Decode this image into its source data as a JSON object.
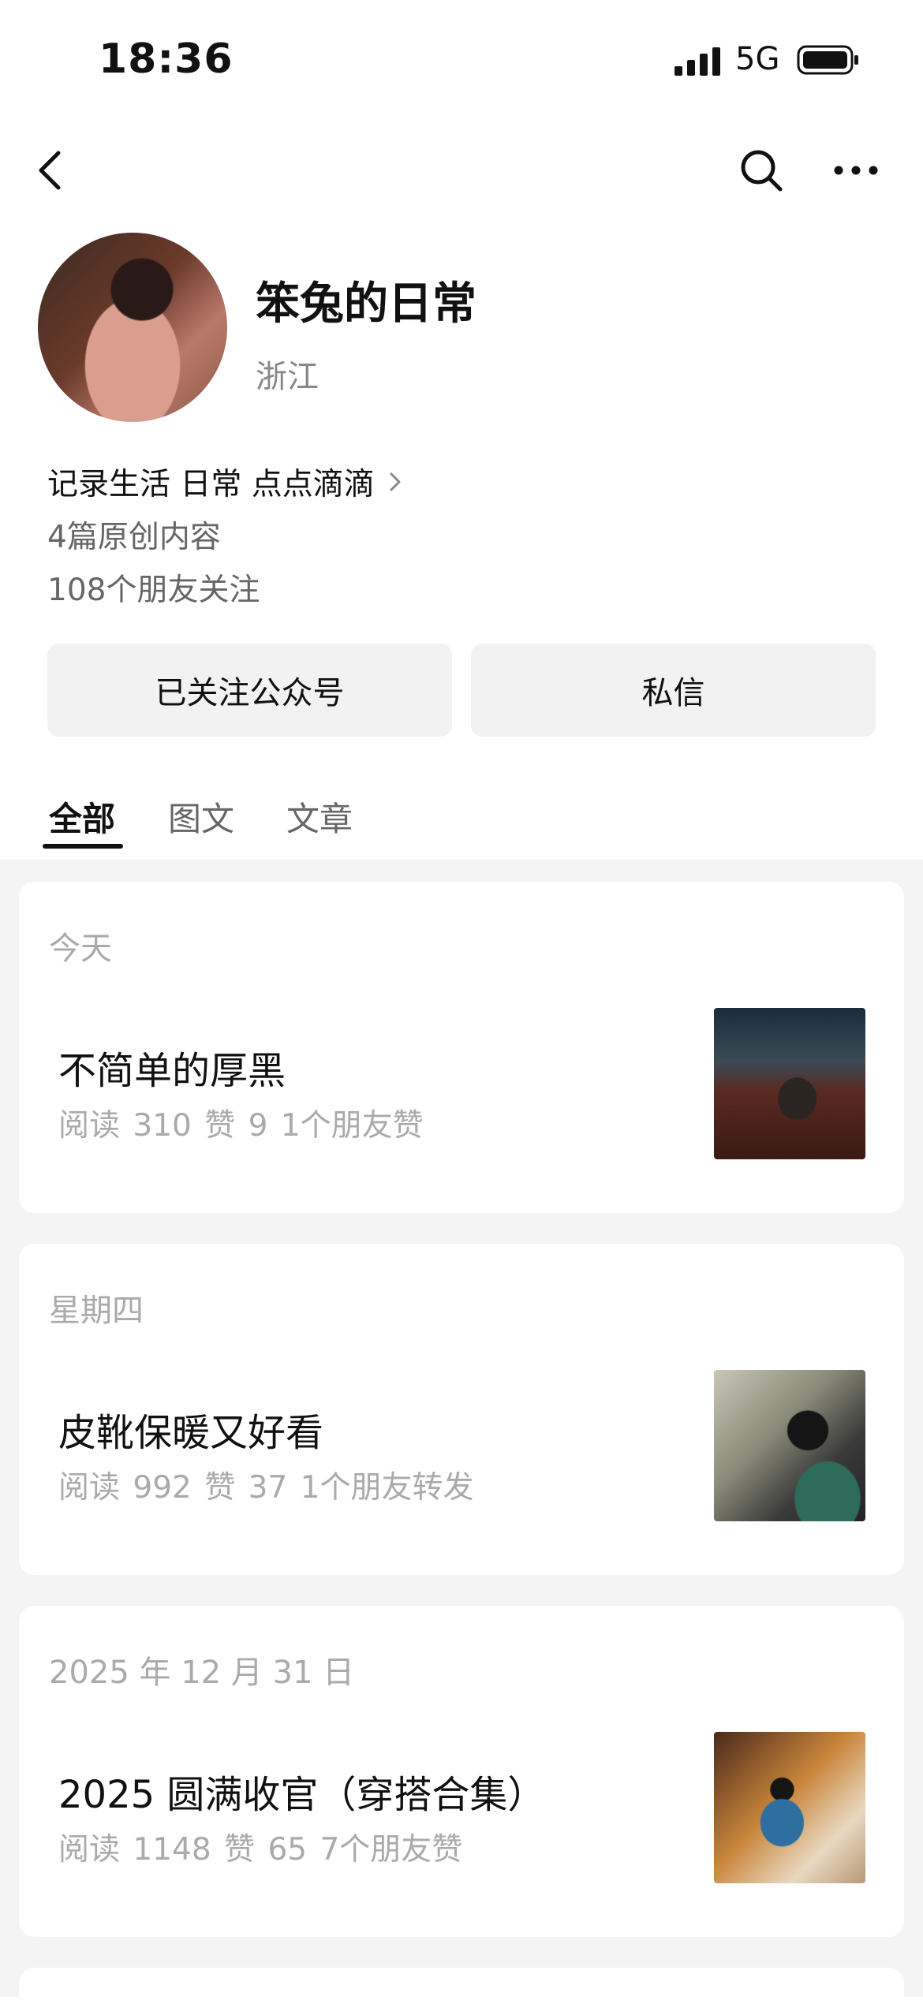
{
  "status_bar": {
    "time": "18:36",
    "network": "5G"
  },
  "profile": {
    "name": "笨兔的日常",
    "region": "浙江",
    "bio": "记录生活 日常 点点滴滴",
    "original_count": "4篇原创内容",
    "friends_following": "108个朋友关注"
  },
  "actions": {
    "followed_label": "已关注公众号",
    "message_label": "私信"
  },
  "tabs": [
    {
      "label": "全部",
      "active": true
    },
    {
      "label": "图文",
      "active": false
    },
    {
      "label": "文章",
      "active": false
    }
  ],
  "articles": [
    {
      "date": "今天",
      "title": "不简单的厚黑",
      "meta": "阅读 310  赞 9  1个朋友赞"
    },
    {
      "date": "星期四",
      "title": "皮靴保暖又好看",
      "meta": "阅读 992  赞 37  1个朋友转发"
    },
    {
      "date": "2025 年 12 月 31 日",
      "title": "2025 圆满收官（穿搭合集）",
      "meta": "阅读 1148  赞 65  7个朋友赞"
    }
  ]
}
